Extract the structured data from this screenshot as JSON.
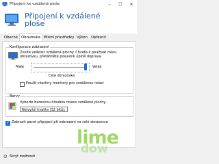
{
  "window": {
    "title": "Připojení ke vzdálené ploše"
  },
  "header": {
    "title_line1": "Připojení k vzdálené",
    "title_line2": "ploše"
  },
  "tabs": [
    {
      "label": "Obecné"
    },
    {
      "label": "Obrazovka"
    },
    {
      "label": "Místní prostředky"
    },
    {
      "label": "Výkon"
    },
    {
      "label": "Upřesnit"
    }
  ],
  "display_config": {
    "group_title": "Konfigurace zobrazení",
    "description": "Zvolte velikost vzdálené plochy. Chcete-li používat celou obrazovku, přetáhněte posuvník úplně doprava.",
    "small_label": "Malá",
    "large_label": "Velká",
    "slider_value_label": "Celá obrazovka",
    "use_all_monitors_label": "Použít všechny monitory pro vzdálenou relaci"
  },
  "colors": {
    "group_title": "Barvy",
    "description": "Vyberte barevnou hloubku relace vzdálené plochy.",
    "selected": "Nejvyšší kvalita (32 bitů)"
  },
  "connection_bar_label": "Zobrazit panel připojení při zobrazení na celé obrazovce",
  "footer": {
    "hide_options_label": "Skrýt možnosti"
  },
  "watermark": {
    "line1": "lime",
    "line2": "dow"
  }
}
